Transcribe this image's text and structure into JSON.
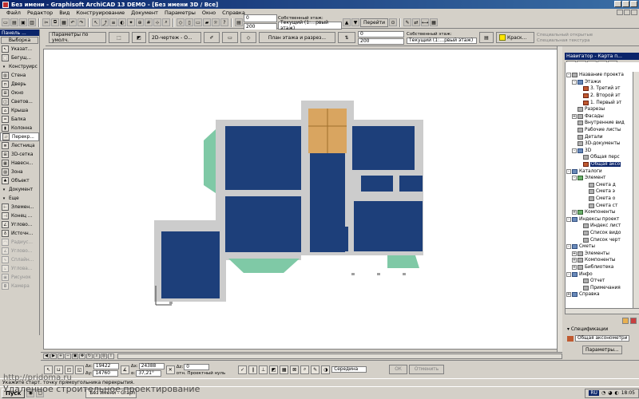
{
  "window": {
    "title": "Без имени - Graphisoft ArchiCAD 13 DEMO - [Без имени 3D / Все]"
  },
  "menu": [
    "Файл",
    "Редактор",
    "Вид",
    "Конструирование",
    "Документ",
    "Параметры",
    "Окно",
    "Справка"
  ],
  "toolbar": {
    "layer_value": "0",
    "layer_value2": "200",
    "own_floor_label": "Собственный этаж:",
    "floor_value": "Текущий (1:…рвый этаж)",
    "go_button": "Перейти",
    "color_label": "Краск...",
    "special_label1": "Специальный открытые",
    "special_label2": "Специальная текстура"
  },
  "infobox": {
    "defaults_label": "Параметры по умолч.",
    "view_mode": "2D-чертеж - О...",
    "floor_plan_button": "План этажа и разрез..."
  },
  "toolbox": {
    "title": "Панель ...",
    "select_tab": "Выборка",
    "items": [
      {
        "label": "Указат...",
        "icon": "arrow-icon",
        "state": "normal"
      },
      {
        "label": "Бегущ...",
        "icon": "marquee-icon",
        "state": "normal"
      },
      {
        "label": "Конструирс",
        "icon": "expand-icon",
        "state": "section"
      },
      {
        "label": "Стена",
        "icon": "wall-icon",
        "state": "normal"
      },
      {
        "label": "Дверь",
        "icon": "door-icon",
        "state": "normal"
      },
      {
        "label": "Окно",
        "icon": "window-icon",
        "state": "normal"
      },
      {
        "label": "Светов...",
        "icon": "skylight-icon",
        "state": "normal"
      },
      {
        "label": "Крыша",
        "icon": "roof-icon",
        "state": "normal"
      },
      {
        "label": "Балка",
        "icon": "beam-icon",
        "state": "normal"
      },
      {
        "label": "Колонна",
        "icon": "column-icon",
        "state": "normal"
      },
      {
        "label": "Перекр...",
        "icon": "slab-icon",
        "state": "active"
      },
      {
        "label": "Лестница",
        "icon": "stair-icon",
        "state": "normal"
      },
      {
        "label": "3D-сетка",
        "icon": "mesh-icon",
        "state": "normal"
      },
      {
        "label": "Навесн...",
        "icon": "curtain-wall-icon",
        "state": "normal"
      },
      {
        "label": "Зона",
        "icon": "zone-icon",
        "state": "normal"
      },
      {
        "label": "Объект",
        "icon": "object-icon",
        "state": "normal"
      },
      {
        "label": "Документ",
        "icon": "expand-icon",
        "state": "section"
      },
      {
        "label": "Еще",
        "icon": "expand-icon",
        "state": "section"
      },
      {
        "label": "Элемен...",
        "icon": "element-icon",
        "state": "normal"
      },
      {
        "label": "Конец ...",
        "icon": "end-icon",
        "state": "normal"
      },
      {
        "label": "Углово...",
        "icon": "corner-icon",
        "state": "normal"
      },
      {
        "label": "Источн...",
        "icon": "lamp-icon",
        "state": "normal"
      },
      {
        "label": "Радиус...",
        "icon": "radius-icon",
        "state": "disabled"
      },
      {
        "label": "Углово...",
        "icon": "angle-icon",
        "state": "disabled"
      },
      {
        "label": "Сплайн...",
        "icon": "spline-icon",
        "state": "disabled"
      },
      {
        "label": "Углова...",
        "icon": "corner-dim-icon",
        "state": "disabled"
      },
      {
        "label": "Рисунок",
        "icon": "picture-icon",
        "state": "disabled"
      },
      {
        "label": "Камера",
        "icon": "camera-icon",
        "state": "disabled"
      }
    ]
  },
  "navigator": {
    "title": "Навигатор - Карта п...",
    "tree": [
      {
        "label": "Название проекта",
        "indent": 0,
        "exp": "-",
        "icon": "grey"
      },
      {
        "label": "Этажи",
        "indent": 1,
        "exp": "-",
        "icon": "blue"
      },
      {
        "label": "3. Третий эт",
        "indent": 2,
        "exp": "",
        "icon": "red"
      },
      {
        "label": "2. Второй эт",
        "indent": 2,
        "exp": "",
        "icon": "red"
      },
      {
        "label": "1. Первый эт",
        "indent": 2,
        "exp": "",
        "icon": "red"
      },
      {
        "label": "Разрезы",
        "indent": 1,
        "exp": "",
        "icon": "grey"
      },
      {
        "label": "Фасады",
        "indent": 1,
        "exp": "+",
        "icon": "grey"
      },
      {
        "label": "Внутренние вид",
        "indent": 1,
        "exp": "",
        "icon": "grey"
      },
      {
        "label": "Рабочие листы",
        "indent": 1,
        "exp": "",
        "icon": "grey"
      },
      {
        "label": "Детали",
        "indent": 1,
        "exp": "",
        "icon": "grey"
      },
      {
        "label": "3D-документы",
        "indent": 1,
        "exp": "",
        "icon": "grey"
      },
      {
        "label": "3D",
        "indent": 1,
        "exp": "-",
        "icon": "blue"
      },
      {
        "label": "Общая перс",
        "indent": 2,
        "exp": "",
        "icon": "grey"
      },
      {
        "label": "Общая аксо",
        "indent": 2,
        "exp": "",
        "icon": "red",
        "selected": true
      },
      {
        "label": "Каталоги",
        "indent": 0,
        "exp": "-",
        "icon": "blue"
      },
      {
        "label": "Элемент",
        "indent": 1,
        "exp": "-",
        "icon": "green"
      },
      {
        "label": "Смета д",
        "indent": 3,
        "exp": "",
        "icon": "grey"
      },
      {
        "label": "Смета э",
        "indent": 3,
        "exp": "",
        "icon": "grey"
      },
      {
        "label": "Смета о",
        "indent": 3,
        "exp": "",
        "icon": "grey"
      },
      {
        "label": "Смета ст",
        "indent": 3,
        "exp": "",
        "icon": "grey"
      },
      {
        "label": "Компоненты",
        "indent": 1,
        "exp": "+",
        "icon": "green"
      },
      {
        "label": "Индексы проект",
        "indent": 0,
        "exp": "-",
        "icon": "blue"
      },
      {
        "label": "Индекс лист",
        "indent": 2,
        "exp": "",
        "icon": "grey"
      },
      {
        "label": "Список видо",
        "indent": 2,
        "exp": "",
        "icon": "grey"
      },
      {
        "label": "Список черт",
        "indent": 2,
        "exp": "",
        "icon": "grey"
      },
      {
        "label": "Сметы",
        "indent": 0,
        "exp": "-",
        "icon": "blue"
      },
      {
        "label": "Элементы",
        "indent": 1,
        "exp": "+",
        "icon": "grey"
      },
      {
        "label": "Компоненты",
        "indent": 1,
        "exp": "+",
        "icon": "grey"
      },
      {
        "label": "Библиотека",
        "indent": 1,
        "exp": "+",
        "icon": "grey"
      },
      {
        "label": "Инфо",
        "indent": 0,
        "exp": "-",
        "icon": "blue"
      },
      {
        "label": "Отчет",
        "indent": 2,
        "exp": "",
        "icon": "grey"
      },
      {
        "label": "Примечания",
        "indent": 2,
        "exp": "",
        "icon": "grey"
      },
      {
        "label": "Справка",
        "indent": 0,
        "exp": "+",
        "icon": "blue"
      }
    ],
    "specs_label": "Спецификации",
    "specs_value": "Общая аксонометри",
    "params_button": "Параметры..."
  },
  "bottombar": {
    "dx_label": "Δx:",
    "dx_value": "19422",
    "dy_label": "Δy:",
    "dy_value": "14760",
    "ax_label": "Δx:",
    "ax_value": "24388",
    "ay_label": "α:",
    "ay_value": "37,21°",
    "dz_label": "Δz:",
    "dz_value": "0",
    "ref_label": "отн. Проектный нуль",
    "snap_label": "Середина",
    "ok_button": "ОК",
    "cancel_button": "Отменить"
  },
  "statusbar": {
    "text": "Укажите старт. точку прямоугольника перекрытия."
  },
  "taskbar": {
    "start_label": "Пуск",
    "task_label": "Без имени - Graphisoft...",
    "lang": "RU",
    "time": "18:05"
  },
  "overlay": {
    "url": "http://pridoma.ru",
    "slogan": "Удаленное строительное проектирование"
  },
  "colors": {
    "floor_blue": "#1d3f7a",
    "wall_grey": "#cccccc",
    "stair_tan": "#d9a560",
    "roof_green": "#7fc9a6"
  }
}
